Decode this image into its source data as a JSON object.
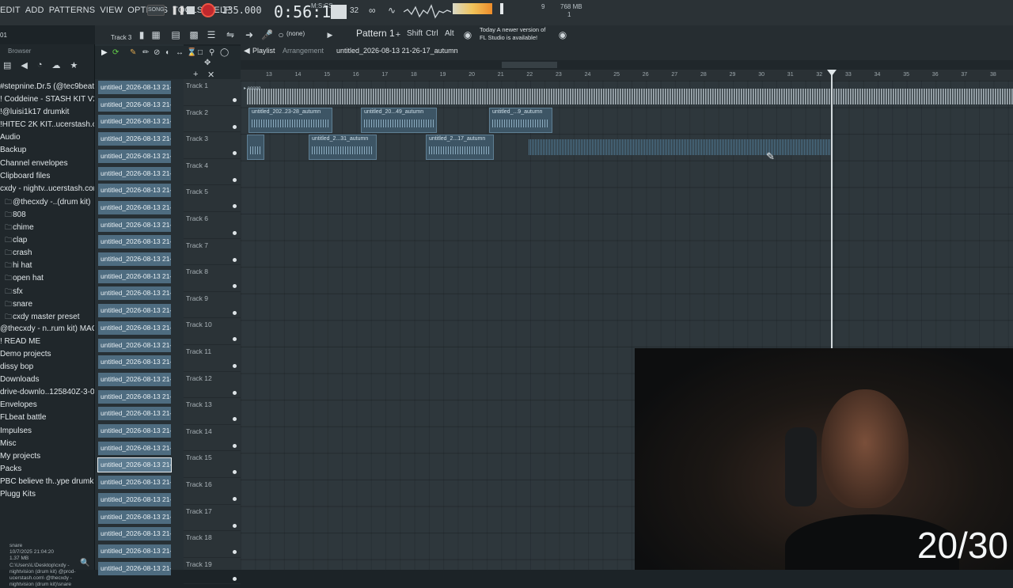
{
  "menu": [
    "EDIT",
    "ADD",
    "PATTERNS",
    "VIEW",
    "OPTIONS",
    "TOOLS",
    "HELP"
  ],
  "transport": {
    "song_badge": "SONG",
    "bpm": "135.000",
    "time": "0:56:13",
    "time_unit": "M:S:CS",
    "cpu": "9",
    "mem": "768 MB",
    "mem_sub": "1"
  },
  "toolbar2": {
    "track_label": "Track 3",
    "none_label": "(none)",
    "pattern": "Pattern 1",
    "keys": [
      "Shift",
      "Ctrl",
      "Alt"
    ],
    "update_line1": "Today  A newer version of",
    "update_line2": "FL Studio is available!"
  },
  "playlist": {
    "title": "Playlist",
    "subtitle": "Arrangement",
    "file": "untitled_2026-08-13 21-26-17_autumn",
    "ruler": [
      "13",
      "14",
      "15",
      "16",
      "17",
      "18",
      "19",
      "20",
      "21",
      "22",
      "23",
      "24",
      "25",
      "26",
      "27",
      "28",
      "29",
      "30",
      "31",
      "32",
      "33",
      "34",
      "35",
      "36",
      "37",
      "38"
    ]
  },
  "browser": {
    "header": "Browser",
    "items": [
      {
        "label": "#stepnine.Dr.5 (@tec9beat)",
        "sub": false
      },
      {
        "label": "! Coddeine - STASH KIT V2 !",
        "sub": false
      },
      {
        "label": "!@luisi1k17 drumkit",
        "sub": false
      },
      {
        "label": "!HITEC 2K KIT..ucerstash.com",
        "sub": false
      },
      {
        "label": "Audio",
        "sub": false
      },
      {
        "label": "Backup",
        "sub": false
      },
      {
        "label": "Channel envelopes",
        "sub": false
      },
      {
        "label": "Clipboard files",
        "sub": false
      },
      {
        "label": "cxdy - nightv..ucerstash.com",
        "sub": false
      },
      {
        "label": "@thecxdy -..(drum kit)",
        "sub": true
      },
      {
        "label": "808",
        "sub": true
      },
      {
        "label": "chime",
        "sub": true
      },
      {
        "label": "clap",
        "sub": true
      },
      {
        "label": "crash",
        "sub": true
      },
      {
        "label": "hi hat",
        "sub": true
      },
      {
        "label": "open hat",
        "sub": true
      },
      {
        "label": "sfx",
        "sub": true
      },
      {
        "label": "snare",
        "sub": true
      },
      {
        "label": "cxdy master preset",
        "sub": true
      },
      {
        "label": "@thecxdy - n..rum kit) MAC",
        "sub": false
      },
      {
        "label": "! READ ME",
        "sub": false
      },
      {
        "label": "Demo projects",
        "sub": false
      },
      {
        "label": "dissy bop",
        "sub": false
      },
      {
        "label": "Downloads",
        "sub": false
      },
      {
        "label": "drive-downlo..125840Z-3-001",
        "sub": false
      },
      {
        "label": "Envelopes",
        "sub": false
      },
      {
        "label": "FLbeat battle",
        "sub": false
      },
      {
        "label": "Impulses",
        "sub": false
      },
      {
        "label": "Misc",
        "sub": false
      },
      {
        "label": "My projects",
        "sub": false
      },
      {
        "label": "Packs",
        "sub": false
      },
      {
        "label": "PBC believe th..ype drumkit 1",
        "sub": false
      },
      {
        "label": "Plugg Kits",
        "sub": false
      }
    ],
    "file_info": "snare\n10/7/2025 21:04:20\n1.37 MB\nC:\\Users\\L\\Desktop\\cxdy - nightvision (drum kit) @prod-ucerstash.com\\ @thecxdy - nightvision (drum kit)\\snare"
  },
  "channel_label": "untitled_2026-08-13 21-",
  "tracks": [
    "Track 1",
    "Track 2",
    "Track 3",
    "Track 4",
    "Track 5",
    "Track 6",
    "Track 7",
    "Track 8",
    "Track 9",
    "Track 10",
    "Track 11",
    "Track 12",
    "Track 13",
    "Track 14",
    "Track 15",
    "Track 16",
    "Track 17",
    "Track 18",
    "Track 19"
  ],
  "clips": [
    {
      "label": "untitled_202..23-28_autumn"
    },
    {
      "label": "untitled_20...49_autumn"
    },
    {
      "label": "untitled_...9_autumn"
    },
    {
      "label": "untitled_2...31_autumn"
    },
    {
      "label": "untitled_2...17_autumn"
    }
  ],
  "overlay_counter": "20/30"
}
